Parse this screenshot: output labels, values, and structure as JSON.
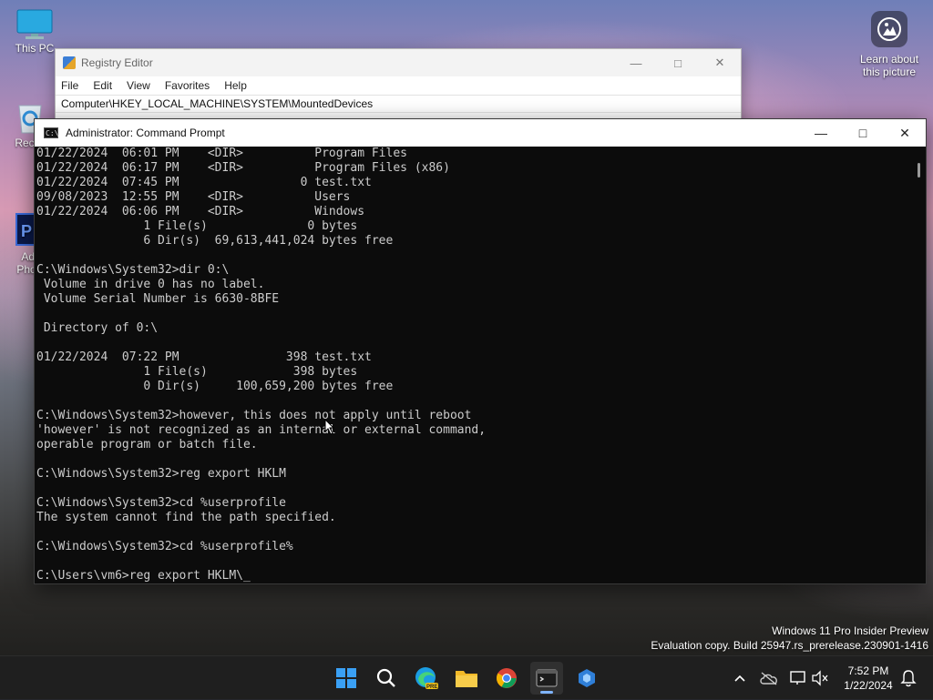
{
  "desktop": {
    "icons": [
      {
        "label": "This PC"
      },
      {
        "label": "Recyc"
      },
      {
        "label": "Ado\nPhoto"
      }
    ],
    "learn_label": "Learn about this picture"
  },
  "regedit": {
    "title": "Registry Editor",
    "menu": [
      "File",
      "Edit",
      "View",
      "Favorites",
      "Help"
    ],
    "address": "Computer\\HKEY_LOCAL_MACHINE\\SYSTEM\\MountedDevices"
  },
  "cmd": {
    "title": "Administrator: Command Prompt",
    "lines": [
      "01/22/2024  06:01 PM    <DIR>          Program Files",
      "01/22/2024  06:17 PM    <DIR>          Program Files (x86)",
      "01/22/2024  07:45 PM                 0 test.txt",
      "09/08/2023  12:55 PM    <DIR>          Users",
      "01/22/2024  06:06 PM    <DIR>          Windows",
      "               1 File(s)              0 bytes",
      "               6 Dir(s)  69,613,441,024 bytes free",
      "",
      "C:\\Windows\\System32>dir 0:\\",
      " Volume in drive 0 has no label.",
      " Volume Serial Number is 6630-8BFE",
      "",
      " Directory of 0:\\",
      "",
      "01/22/2024  07:22 PM               398 test.txt",
      "               1 File(s)            398 bytes",
      "               0 Dir(s)     100,659,200 bytes free",
      "",
      "C:\\Windows\\System32>however, this does not apply until reboot",
      "'however' is not recognized as an internal or external command,",
      "operable program or batch file.",
      "",
      "C:\\Windows\\System32>reg export HKLM",
      "",
      "C:\\Windows\\System32>cd %userprofile",
      "The system cannot find the path specified.",
      "",
      "C:\\Windows\\System32>cd %userprofile%",
      "",
      "C:\\Users\\vm6>reg export HKLM\\_"
    ]
  },
  "watermark": {
    "line1": "Windows 11 Pro Insider Preview",
    "line2": "Evaluation copy. Build 25947.rs_prerelease.230901-1416"
  },
  "taskbar": {
    "apps": [
      "start-icon",
      "search-icon",
      "edge-icon",
      "file-explorer-icon",
      "chrome-icon",
      "terminal-icon",
      "app-icon"
    ],
    "time": "7:52 PM",
    "date": "1/22/2024"
  },
  "colors": {
    "console_bg": "#0c0c0c",
    "console_text": "#cccccc",
    "accent": "#7fb4ff"
  }
}
